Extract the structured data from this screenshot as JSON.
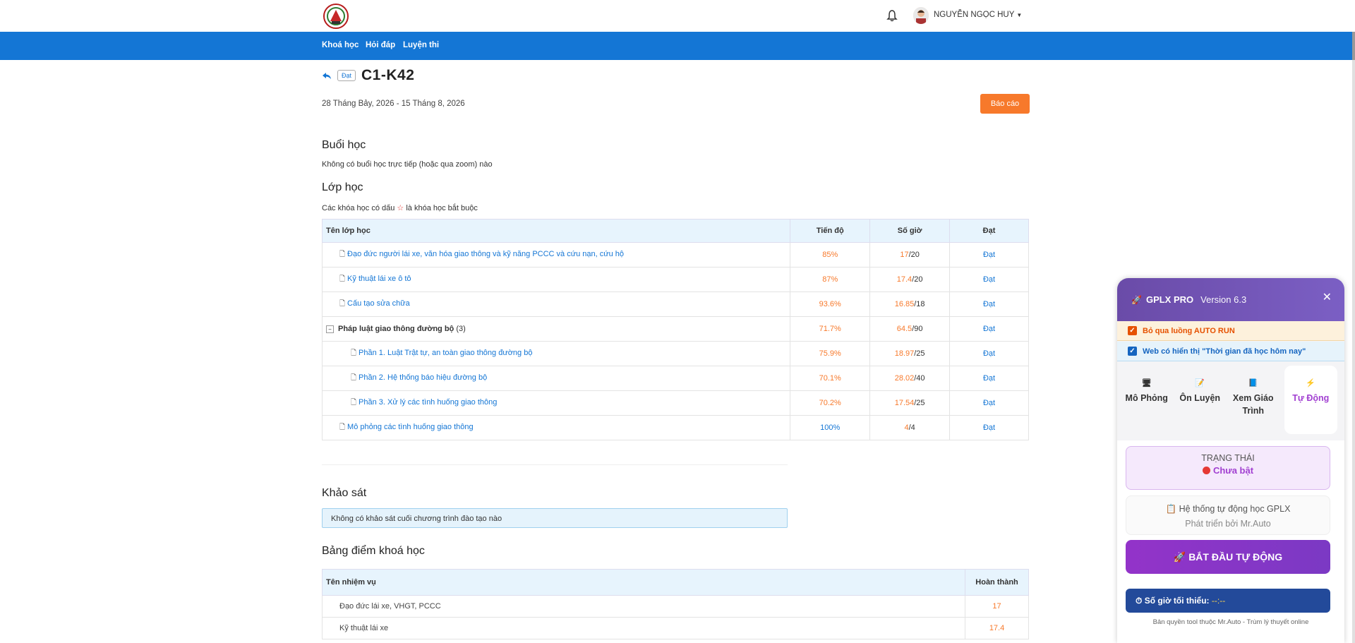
{
  "header": {
    "user_name": "NGUYỄN NGỌC HUY"
  },
  "nav": [
    "Khoá học",
    "Hỏi đáp",
    "Luyện thi"
  ],
  "course": {
    "status_badge": "Đạt",
    "title": "C1-K42",
    "date_range": "28 Tháng Bảy, 2026 - 15 Tháng 8, 2026",
    "report_button": "Báo cáo"
  },
  "sessions": {
    "heading": "Buổi học",
    "note": "Không có buổi học trực tiếp (hoặc qua zoom) nào"
  },
  "classes": {
    "heading": "Lớp học",
    "note_before": "Các khóa học có dấu ",
    "note_star": "☆",
    "note_after": " là khóa học bắt buộc",
    "columns": [
      "Tên lớp học",
      "Tiến độ",
      "Số giờ",
      "Đạt"
    ],
    "rows": [
      {
        "name": "Đạo đức người lái xe, văn hóa giao thông và kỹ năng PCCC và cứu nạn, cứu hộ",
        "progress": "85%",
        "hours": "17",
        "total": "/20",
        "status": "Đạt"
      },
      {
        "name": "Kỹ thuật lái xe ô tô",
        "progress": "87%",
        "hours": "17.4",
        "total": "/20",
        "status": "Đạt"
      },
      {
        "name": "Cấu tạo sửa chữa",
        "progress": "93.6%",
        "hours": "16.85",
        "total": "/18",
        "status": "Đạt"
      },
      {
        "name": "Pháp luật giao thông đường bộ",
        "count": "(3)",
        "progress": "71.7%",
        "hours": "64.5",
        "total": "/90",
        "status": "Đạt"
      },
      {
        "name": "Phần 1. Luật Trật tự, an toàn giao thông đường bộ",
        "progress": "75.9%",
        "hours": "18.97",
        "total": "/25",
        "status": "Đạt"
      },
      {
        "name": "Phần 2. Hệ thống báo hiệu đường bộ",
        "progress": "70.1%",
        "hours": "28.02",
        "total": "/40",
        "status": "Đạt"
      },
      {
        "name": "Phần 3. Xử lý các tình huống giao thông",
        "progress": "70.2%",
        "hours": "17.54",
        "total": "/25",
        "status": "Đạt"
      },
      {
        "name": "Mô phỏng các tình huống giao thông",
        "progress": "100%",
        "hours": "4",
        "total": "/4",
        "status": "Đạt"
      }
    ]
  },
  "survey": {
    "heading": "Khảo sát",
    "note": "Không có khảo sát cuối chương trình đào tạo nào"
  },
  "scores": {
    "heading": "Bảng điểm khoá học",
    "columns": [
      "Tên nhiệm vụ",
      "Hoàn thành"
    ],
    "rows": [
      {
        "name": "Đạo đức lái xe, VHGT, PCCC",
        "value": "17"
      },
      {
        "name": "Kỹ thuật lái xe",
        "value": "17.4"
      }
    ]
  },
  "panel": {
    "name": "GPLX PRO",
    "version": "Version 6.3",
    "close": "✕",
    "option1": "Bỏ qua luồng AUTO RUN",
    "option2": "Web có hiển thị \"Thời gian đã học hôm nay\"",
    "tabs": [
      {
        "label": "Mô Phỏng",
        "icon": "monitor-icon"
      },
      {
        "label": "Ôn Luyện",
        "icon": "notebook-icon"
      },
      {
        "label": "Xem Giáo Trình",
        "icon": "book-icon"
      },
      {
        "label": "Tự Động",
        "icon": "lightning-icon"
      }
    ],
    "status_label": "TRẠNG THÁI",
    "status_value": "Chưa bật",
    "system_line1": "Hệ thống tự động học GPLX",
    "system_line2": "Phát triển bởi Mr.Auto",
    "start_button": "BẮT ĐẦU TỰ ĐỘNG",
    "min_hours_label": "Số giờ tối thiểu:",
    "min_hours_value": "--:--",
    "copyright": "Bản quyền tool thuộc Mr.Auto - Trùm lý thuyết online"
  },
  "colors": {
    "nav_blue": "#1476d5",
    "accent_orange": "#f7792b",
    "panel_purple": "#7b5fc4"
  }
}
